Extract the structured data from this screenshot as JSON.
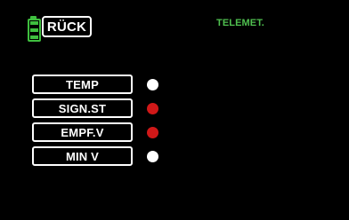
{
  "header": {
    "back_label": "RÜCK",
    "title": "TELEMET.",
    "battery_icon": "battery-icon",
    "battery_color": "#3fbf3f",
    "title_color": "#4fbf4f"
  },
  "menu": {
    "items": [
      {
        "label": "TEMP",
        "indicator": "white",
        "indicator_color": "#ffffff"
      },
      {
        "label": "SIGN.ST",
        "indicator": "red",
        "indicator_color": "#d01818"
      },
      {
        "label": "EMPF.V",
        "indicator": "red",
        "indicator_color": "#d01818"
      },
      {
        "label": "MIN V",
        "indicator": "white",
        "indicator_color": "#ffffff"
      }
    ]
  }
}
